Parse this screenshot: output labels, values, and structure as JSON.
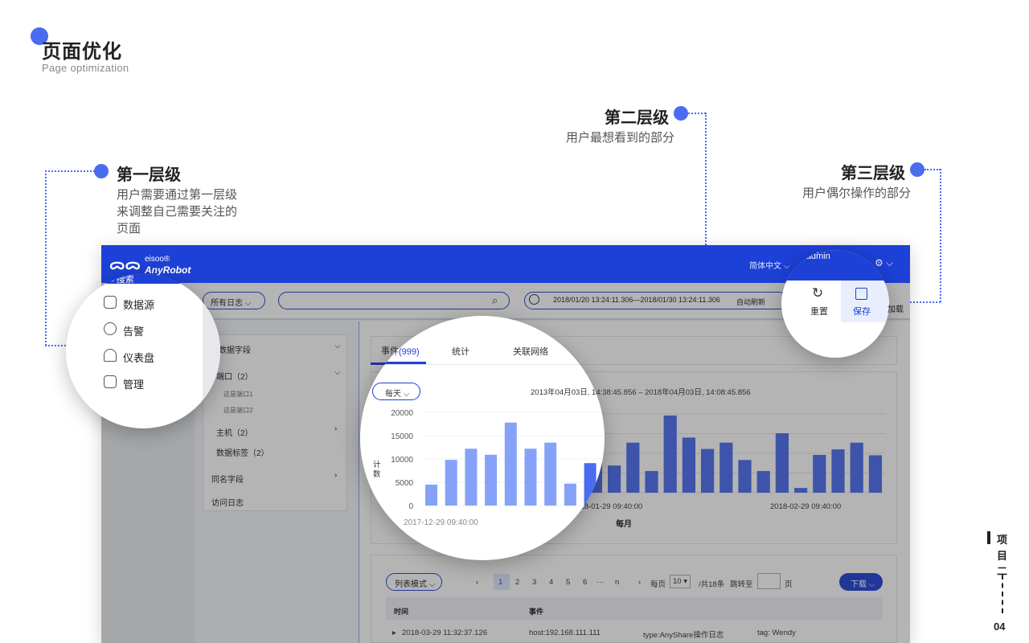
{
  "slide": {
    "title": "页面优化",
    "subtitle": "Page optimization",
    "side_tag": [
      "项",
      "目",
      "二"
    ],
    "page_number": "04"
  },
  "callouts": {
    "level1": {
      "title": "第一层级",
      "desc": [
        "用户需要通过第一层级",
        "来调整自己需要关注的",
        "页面"
      ]
    },
    "level2": {
      "title": "第二层级",
      "desc": "用户最想看到的部分"
    },
    "level3": {
      "title": "第三层级",
      "desc": "用户偶尔操作的部分"
    }
  },
  "app": {
    "brand": "eisoo®",
    "name": "AnyRobot",
    "language": "简体中文",
    "user": "admin",
    "back_search": "搜索",
    "log_select": "所有日志",
    "time_range": "2018/01/20 13:24:11.306—2018/01/30 13:24:11.306",
    "auto_refresh": "自动刷新",
    "reset_label": "重置",
    "save_label": "保存",
    "load_label": "加载",
    "sidebar_menu": [
      "数据源",
      "告警",
      "仪表盘",
      "管理"
    ],
    "fields": {
      "header": "数据字段",
      "port": "端口（2）",
      "port_items": [
        "这是端口1",
        "这是端口2"
      ],
      "host": "主机（2）",
      "tags": "数据标签（2）",
      "same_name": "同名字段",
      "access_log": "访问日志"
    },
    "tabs": [
      "事件(999)",
      "统计",
      "关联网络"
    ],
    "period_select": "每天",
    "chart_range": "2013年04月03日, 14:38:45.856 – 2018年04月03日, 14:08:45.856",
    "list_mode": "列表模式",
    "pagination": {
      "pages": [
        "1",
        "2",
        "3",
        "4",
        "5",
        "6",
        "···",
        "n"
      ],
      "per_page_label": "每页",
      "per_page_value": "10",
      "total": "/共18条",
      "jump_label": "跳转至",
      "page_suffix": "页"
    },
    "download_label": "下载",
    "table": {
      "headers": [
        "时间",
        "事件"
      ],
      "rows": [
        {
          "time": "2018-03-29  11:32:37.126",
          "host": "host:192.168.111.111",
          "type": "type:AnyShare操作日志",
          "tag": "tag:  Wendy"
        }
      ]
    }
  },
  "chart_data": {
    "type": "bar",
    "ylabel": "计数",
    "xlabel": "每月",
    "ylim": [
      0,
      20000
    ],
    "yticks": [
      0,
      5000,
      10000,
      15000,
      20000
    ],
    "xtick_labels": [
      "2017-12-29 09:40:00",
      "2018-01-29 09:40:00",
      "2018-02-29 09:40:00"
    ],
    "series": [
      {
        "values": [
          4500,
          9800,
          12200,
          10900,
          17800,
          12200,
          13500,
          4700,
          9100,
          8800,
          6900,
          12700,
          5500,
          19600,
          14000,
          11100,
          12700,
          8300,
          5500,
          15100,
          1200,
          9600,
          11000,
          12700,
          9500
        ]
      }
    ],
    "colors": {
      "bar": "#4a6cf0",
      "bar_light": "#86a2f8"
    }
  }
}
